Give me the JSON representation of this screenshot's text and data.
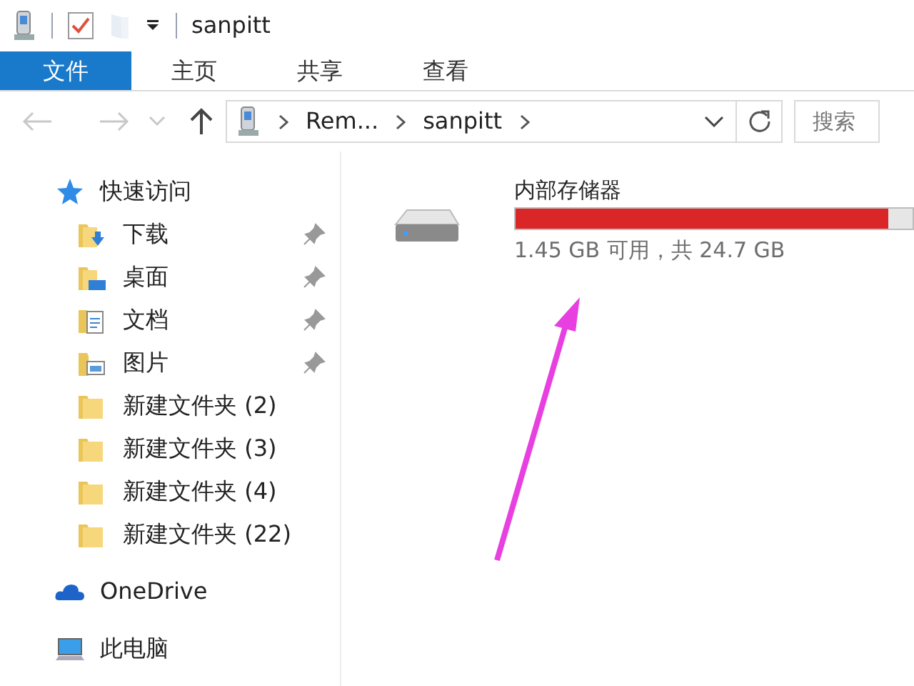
{
  "window": {
    "title": "sanpitt"
  },
  "ribbon_tabs": [
    {
      "label": "文件",
      "selected": true
    },
    {
      "label": "主页",
      "selected": false
    },
    {
      "label": "共享",
      "selected": false
    },
    {
      "label": "查看",
      "selected": false
    }
  ],
  "address_bar": {
    "segments": [
      "Rem...",
      "sanpitt"
    ]
  },
  "search": {
    "placeholder": "搜索"
  },
  "sidebar": {
    "items": [
      {
        "label": "快速访问",
        "children": [
          {
            "label": "下载",
            "pinned": true
          },
          {
            "label": "桌面",
            "pinned": true
          },
          {
            "label": "文档",
            "pinned": true
          },
          {
            "label": "图片",
            "pinned": true
          },
          {
            "label": "新建文件夹 (2)",
            "pinned": false
          },
          {
            "label": "新建文件夹 (3)",
            "pinned": false
          },
          {
            "label": "新建文件夹 (4)",
            "pinned": false
          },
          {
            "label": "新建文件夹 (22)",
            "pinned": false
          }
        ]
      },
      {
        "label": "OneDrive"
      },
      {
        "label": "此电脑"
      }
    ]
  },
  "drives": [
    {
      "name": "内部存储器",
      "level": 0.94,
      "free_text": "1.45 GB 可用，共 24.7 GB"
    }
  ]
}
